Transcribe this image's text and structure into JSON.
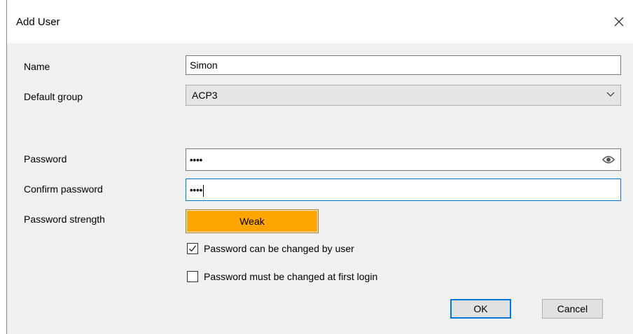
{
  "dialog": {
    "title": "Add User"
  },
  "form": {
    "name_label": "Name",
    "name_value": "Simon",
    "group_label": "Default group",
    "group_value": "ACP3",
    "password_label": "Password",
    "password_value": "••••",
    "confirm_label": "Confirm password",
    "confirm_value": "••••",
    "strength_label": "Password strength",
    "strength_value": "Weak",
    "strength_color": "#ffa500"
  },
  "options": [
    {
      "label": "Password can be changed by user",
      "checked": true
    },
    {
      "label": "Password must be changed at first login",
      "checked": false
    }
  ],
  "buttons": {
    "ok": "OK",
    "cancel": "Cancel"
  },
  "icons": {
    "close": "close-icon",
    "dropdown": "chevron-down-icon",
    "reveal": "eye-icon",
    "check": "checkmark-icon"
  },
  "colors": {
    "focus_border": "#0078d7",
    "content_bg": "#f0f0f0"
  }
}
